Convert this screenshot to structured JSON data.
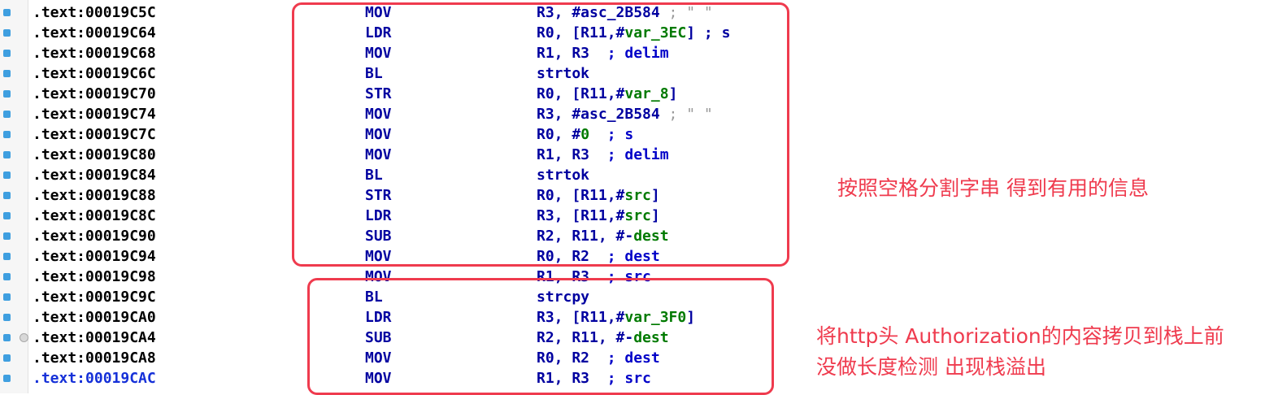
{
  "rows": [
    {
      "address": ".text:00019C5C",
      "mnemonic": "MOV",
      "operands": [
        {
          "t": "R3, #asc_2B584",
          "c": ""
        },
        {
          "t": " ; \" \"",
          "c": "gray"
        }
      ]
    },
    {
      "address": ".text:00019C64",
      "mnemonic": "LDR",
      "operands": [
        {
          "t": "R0, [R11,#",
          "c": ""
        },
        {
          "t": "var_3EC",
          "c": "g"
        },
        {
          "t": "] ; s",
          "c": ""
        }
      ]
    },
    {
      "address": ".text:00019C68",
      "mnemonic": "MOV",
      "operands": [
        {
          "t": "R1, R3  ",
          "c": ""
        },
        {
          "t": "; delim",
          "c": "cm"
        }
      ]
    },
    {
      "address": ".text:00019C6C",
      "mnemonic": "BL",
      "operands": [
        {
          "t": "strtok",
          "c": ""
        }
      ]
    },
    {
      "address": ".text:00019C70",
      "mnemonic": "STR",
      "operands": [
        {
          "t": "R0, [R11,#",
          "c": ""
        },
        {
          "t": "var_8",
          "c": "g"
        },
        {
          "t": "]",
          "c": ""
        }
      ]
    },
    {
      "address": ".text:00019C74",
      "mnemonic": "MOV",
      "operands": [
        {
          "t": "R3, #asc_2B584",
          "c": ""
        },
        {
          "t": " ; \" \"",
          "c": "gray"
        }
      ]
    },
    {
      "address": ".text:00019C7C",
      "mnemonic": "MOV",
      "operands": [
        {
          "t": "R0, #",
          "c": ""
        },
        {
          "t": "0",
          "c": "g"
        },
        {
          "t": "  ",
          "c": ""
        },
        {
          "t": "; s",
          "c": "cm"
        }
      ]
    },
    {
      "address": ".text:00019C80",
      "mnemonic": "MOV",
      "operands": [
        {
          "t": "R1, R3  ",
          "c": ""
        },
        {
          "t": "; delim",
          "c": "cm"
        }
      ]
    },
    {
      "address": ".text:00019C84",
      "mnemonic": "BL",
      "operands": [
        {
          "t": "strtok",
          "c": ""
        }
      ]
    },
    {
      "address": ".text:00019C88",
      "mnemonic": "STR",
      "operands": [
        {
          "t": "R0, [R11,#",
          "c": ""
        },
        {
          "t": "src",
          "c": "g"
        },
        {
          "t": "]",
          "c": ""
        }
      ]
    },
    {
      "address": ".text:00019C8C",
      "mnemonic": "LDR",
      "operands": [
        {
          "t": "R3, [R11,#",
          "c": ""
        },
        {
          "t": "src",
          "c": "g"
        },
        {
          "t": "]",
          "c": ""
        }
      ]
    },
    {
      "address": ".text:00019C90",
      "mnemonic": "SUB",
      "operands": [
        {
          "t": "R2, R11, #-",
          "c": ""
        },
        {
          "t": "dest",
          "c": "g"
        }
      ]
    },
    {
      "address": ".text:00019C94",
      "mnemonic": "MOV",
      "operands": [
        {
          "t": "R0, R2  ",
          "c": ""
        },
        {
          "t": "; dest",
          "c": "cm"
        }
      ]
    },
    {
      "address": ".text:00019C98",
      "mnemonic": "MOV",
      "operands": [
        {
          "t": "R1, R3  ",
          "c": ""
        },
        {
          "t": "; src",
          "c": "cm"
        }
      ]
    },
    {
      "address": ".text:00019C9C",
      "mnemonic": "BL",
      "operands": [
        {
          "t": "strcpy",
          "c": ""
        }
      ]
    },
    {
      "address": ".text:00019CA0",
      "mnemonic": "LDR",
      "operands": [
        {
          "t": "R3, [R11,#",
          "c": ""
        },
        {
          "t": "var_3F0",
          "c": "g"
        },
        {
          "t": "]",
          "c": ""
        }
      ]
    },
    {
      "address": ".text:00019CA4",
      "mnemonic": "SUB",
      "operands": [
        {
          "t": "R2, R11, #-",
          "c": ""
        },
        {
          "t": "dest",
          "c": "g"
        }
      ]
    },
    {
      "address": ".text:00019CA8",
      "mnemonic": "MOV",
      "operands": [
        {
          "t": "R0, R2  ",
          "c": ""
        },
        {
          "t": "; dest",
          "c": "cm"
        }
      ]
    },
    {
      "address": ".text:00019CAC",
      "mnemonic": "MOV",
      "operands": [
        {
          "t": "R1, R3  ",
          "c": ""
        },
        {
          "t": "; src",
          "c": "cm"
        }
      ]
    }
  ],
  "current_address_index": 18,
  "breakpoint_index": 16,
  "annotation_top": "按照空格分割字串 得到有用的信息",
  "annotation_bottom_line1": "将http头 Authorization的内容拷贝到栈上前",
  "annotation_bottom_line2": "没做长度检测 出现栈溢出",
  "colors": {
    "annotation": "#ef3b4e",
    "mnemonic": "#0000a0",
    "variable": "#007a00",
    "current_address": "#1530d8",
    "gutter_marker": "#3f9fe0"
  }
}
